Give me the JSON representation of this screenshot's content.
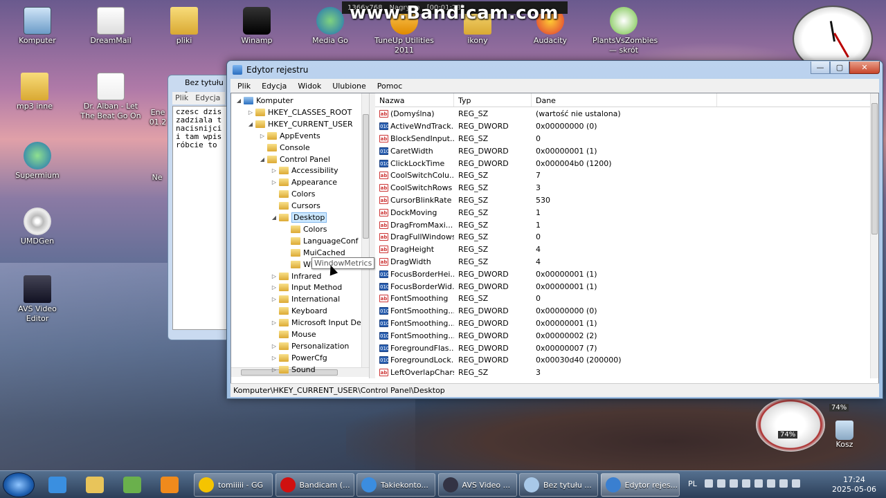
{
  "recording": {
    "watermark": "www.Bandicam.com",
    "info": "1366x768",
    "status": "Nagrywa",
    "timer": "[00:01:28]"
  },
  "desktop_icons": [
    {
      "label": "Komputer",
      "kind": "comp"
    },
    {
      "label": "DreamMail",
      "kind": "mail"
    },
    {
      "label": "pliki",
      "kind": "folder"
    },
    {
      "label": "Winamp",
      "kind": "winamp"
    },
    {
      "label": "Media Go",
      "kind": "media"
    },
    {
      "label": "TuneUp Utilities 2011",
      "kind": "tuneup"
    },
    {
      "label": "ikony",
      "kind": "folder"
    },
    {
      "label": "Audacity",
      "kind": "audacity"
    },
    {
      "label": "PlantsVsZombies — skrót",
      "kind": "plants"
    },
    {
      "label": "mp3 inne",
      "kind": "folder"
    },
    {
      "label": "Dr. Alban - Let The Beat Go On",
      "kind": "doc"
    },
    {
      "label": "Supermium",
      "kind": "globe"
    },
    {
      "label": "UMDGen",
      "kind": "disc"
    },
    {
      "label": "AVS Video Editor",
      "kind": "film"
    }
  ],
  "desktop_partial": {
    "ene": "Ene",
    "ene2": "01.2",
    "ne": "Ne"
  },
  "gadgets": {
    "meter_cpu": "74%",
    "meter_mem": "74%"
  },
  "trash_label": "Kosz",
  "notepad": {
    "title": "Bez tytułu -",
    "menu": [
      "Plik",
      "Edycja"
    ],
    "text": "czesc dzis\nzadziala t\nnacisnijci\ni tam wpis\nróbcie to"
  },
  "regedit": {
    "title": "Edytor rejestru",
    "menu": [
      "Plik",
      "Edycja",
      "Widok",
      "Ulubione",
      "Pomoc"
    ],
    "tree": [
      {
        "label": "Komputer",
        "level": 0,
        "arrow": "◢",
        "kind": "pc"
      },
      {
        "label": "HKEY_CLASSES_ROOT",
        "level": 1,
        "arrow": "▷",
        "kind": "folder"
      },
      {
        "label": "HKEY_CURRENT_USER",
        "level": 1,
        "arrow": "◢",
        "kind": "folder"
      },
      {
        "label": "AppEvents",
        "level": 2,
        "arrow": "▷",
        "kind": "folder"
      },
      {
        "label": "Console",
        "level": 2,
        "arrow": "",
        "kind": "folder"
      },
      {
        "label": "Control Panel",
        "level": 2,
        "arrow": "◢",
        "kind": "folder"
      },
      {
        "label": "Accessibility",
        "level": 3,
        "arrow": "▷",
        "kind": "folder"
      },
      {
        "label": "Appearance",
        "level": 3,
        "arrow": "▷",
        "kind": "folder"
      },
      {
        "label": "Colors",
        "level": 3,
        "arrow": "",
        "kind": "folder"
      },
      {
        "label": "Cursors",
        "level": 3,
        "arrow": "",
        "kind": "folder"
      },
      {
        "label": "Desktop",
        "level": 3,
        "arrow": "◢",
        "kind": "folder",
        "selected": true
      },
      {
        "label": "Colors",
        "level": 4,
        "arrow": "",
        "kind": "folder"
      },
      {
        "label": "LanguageConf",
        "level": 4,
        "arrow": "",
        "kind": "folder"
      },
      {
        "label": "MuiCached",
        "level": 4,
        "arrow": "",
        "kind": "folder"
      },
      {
        "label": "WindowMetrics",
        "level": 4,
        "arrow": "",
        "kind": "folder"
      },
      {
        "label": "Infrared",
        "level": 3,
        "arrow": "▷",
        "kind": "folder"
      },
      {
        "label": "Input Method",
        "level": 3,
        "arrow": "▷",
        "kind": "folder"
      },
      {
        "label": "International",
        "level": 3,
        "arrow": "▷",
        "kind": "folder"
      },
      {
        "label": "Keyboard",
        "level": 3,
        "arrow": "",
        "kind": "folder"
      },
      {
        "label": "Microsoft Input De",
        "level": 3,
        "arrow": "▷",
        "kind": "folder"
      },
      {
        "label": "Mouse",
        "level": 3,
        "arrow": "",
        "kind": "folder"
      },
      {
        "label": "Personalization",
        "level": 3,
        "arrow": "▷",
        "kind": "folder"
      },
      {
        "label": "PowerCfg",
        "level": 3,
        "arrow": "▷",
        "kind": "folder"
      },
      {
        "label": "Sound",
        "level": 3,
        "arrow": "▷",
        "kind": "folder"
      }
    ],
    "tooltip": "WindowMetrics",
    "columns": [
      "Nazwa",
      "Typ",
      "Dane"
    ],
    "values": [
      {
        "name": "(Domyślna)",
        "type": "REG_SZ",
        "data": "(wartość nie ustalona)"
      },
      {
        "name": "ActiveWndTrack...",
        "type": "REG_DWORD",
        "data": "0x00000000 (0)"
      },
      {
        "name": "BlockSendInput...",
        "type": "REG_SZ",
        "data": "0"
      },
      {
        "name": "CaretWidth",
        "type": "REG_DWORD",
        "data": "0x00000001 (1)"
      },
      {
        "name": "ClickLockTime",
        "type": "REG_DWORD",
        "data": "0x000004b0 (1200)"
      },
      {
        "name": "CoolSwitchColu...",
        "type": "REG_SZ",
        "data": "7"
      },
      {
        "name": "CoolSwitchRows",
        "type": "REG_SZ",
        "data": "3"
      },
      {
        "name": "CursorBlinkRate",
        "type": "REG_SZ",
        "data": "530"
      },
      {
        "name": "DockMoving",
        "type": "REG_SZ",
        "data": "1"
      },
      {
        "name": "DragFromMaxi...",
        "type": "REG_SZ",
        "data": "1"
      },
      {
        "name": "DragFullWindows",
        "type": "REG_SZ",
        "data": "0"
      },
      {
        "name": "DragHeight",
        "type": "REG_SZ",
        "data": "4"
      },
      {
        "name": "DragWidth",
        "type": "REG_SZ",
        "data": "4"
      },
      {
        "name": "FocusBorderHei...",
        "type": "REG_DWORD",
        "data": "0x00000001 (1)"
      },
      {
        "name": "FocusBorderWid...",
        "type": "REG_DWORD",
        "data": "0x00000001 (1)"
      },
      {
        "name": "FontSmoothing",
        "type": "REG_SZ",
        "data": "0"
      },
      {
        "name": "FontSmoothing...",
        "type": "REG_DWORD",
        "data": "0x00000000 (0)"
      },
      {
        "name": "FontSmoothing...",
        "type": "REG_DWORD",
        "data": "0x00000001 (1)"
      },
      {
        "name": "FontSmoothing...",
        "type": "REG_DWORD",
        "data": "0x00000002 (2)"
      },
      {
        "name": "ForegroundFlas...",
        "type": "REG_DWORD",
        "data": "0x00000007 (7)"
      },
      {
        "name": "ForegroundLock...",
        "type": "REG_DWORD",
        "data": "0x00030d40 (200000)"
      },
      {
        "name": "LeftOverlapChars",
        "type": "REG_SZ",
        "data": "3"
      }
    ],
    "status_path": "Komputer\\HKEY_CURRENT_USER\\Control Panel\\Desktop"
  },
  "taskbar": {
    "pinned": [
      {
        "name": "ie",
        "color": "#3a8fe0"
      },
      {
        "name": "explorer",
        "color": "#e8c45a"
      },
      {
        "name": "people",
        "color": "#6ab04c"
      },
      {
        "name": "media-player",
        "color": "#f08a1c"
      }
    ],
    "buttons": [
      {
        "label": "tomiiiii - GG",
        "color": "#f5c400"
      },
      {
        "label": "Bandicam (...",
        "color": "#d01010"
      },
      {
        "label": "Takiekonto...",
        "color": "#3b8de0"
      },
      {
        "label": "AVS Video ...",
        "color": "#334"
      },
      {
        "label": "Bez tytułu ...",
        "color": "#a8c8e8"
      },
      {
        "label": "Edytor rejes...",
        "color": "#3a7fd0",
        "active": true
      }
    ],
    "lang": "PL",
    "time": "17:24",
    "date": "2025-05-06"
  }
}
